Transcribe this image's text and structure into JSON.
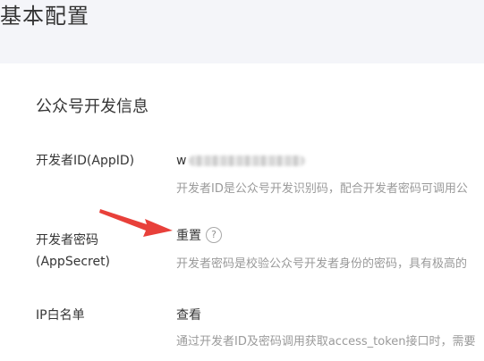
{
  "page": {
    "title": "基本配置"
  },
  "developer_info": {
    "section_title": "公众号开发信息",
    "appid": {
      "label": "开发者ID(AppID)",
      "value_visible": "w",
      "description": "开发者ID是公众号开发识别码，配合开发者密码可调用公"
    },
    "app_secret": {
      "label": "开发者密码(AppSecret)",
      "action_label": "重置",
      "help_icon": "?",
      "description": "开发者密码是校验公众号开发者身份的密码，具有极高的"
    },
    "ip_whitelist": {
      "label": "IP白名单",
      "action_label": "查看",
      "description": "通过开发者ID及密码调用获取access_token接口时，需要"
    }
  },
  "annotation": {
    "color": "#e8403a",
    "icon": "red-arrow-annotation"
  }
}
